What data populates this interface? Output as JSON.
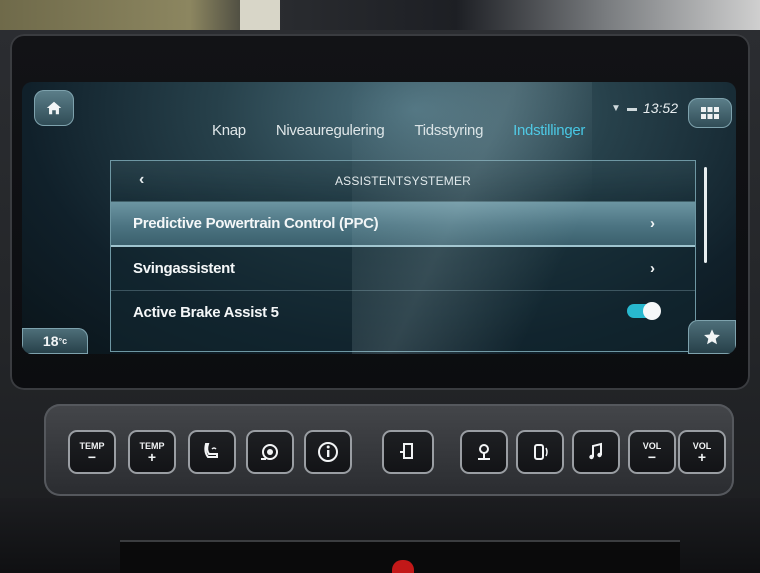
{
  "status": {
    "time": "13:52",
    "signal_icon": "wifi-icon",
    "battery_icon": "battery-icon"
  },
  "tabs": [
    {
      "label": "Knap",
      "active": false
    },
    {
      "label": "Niveauregulering",
      "active": false
    },
    {
      "label": "Tidsstyring",
      "active": false
    },
    {
      "label": "Indstillinger",
      "active": true
    }
  ],
  "panel": {
    "title": "ASSISTENTSYSTEMER",
    "back_icon": "back-chevron-icon",
    "rows": [
      {
        "label": "Predictive Powertrain Control (PPC)",
        "control": "chevron",
        "highlighted": true
      },
      {
        "label": "Svingassistent",
        "control": "chevron",
        "highlighted": false
      },
      {
        "label": "Active Brake Assist 5",
        "control": "toggle",
        "toggle_on": true,
        "highlighted": false
      }
    ]
  },
  "temperature": "18",
  "temperature_unit": "°c",
  "hard_keys": {
    "temp_minus": {
      "label": "TEMP",
      "sign": "−"
    },
    "temp_plus": {
      "label": "TEMP",
      "sign": "+"
    },
    "vol_minus": {
      "label": "VOL",
      "sign": "−"
    },
    "vol_plus": {
      "label": "VOL",
      "sign": "+"
    },
    "icons": [
      "seat-heating-icon",
      "vehicle-settings-icon",
      "info-icon",
      "truck-phone-icon",
      "navigation-icon",
      "radio-icon",
      "music-icon"
    ]
  },
  "colors": {
    "accent": "#3fc7e6",
    "toggle_on": "#28b8cf",
    "highlight": "#5a8593"
  }
}
